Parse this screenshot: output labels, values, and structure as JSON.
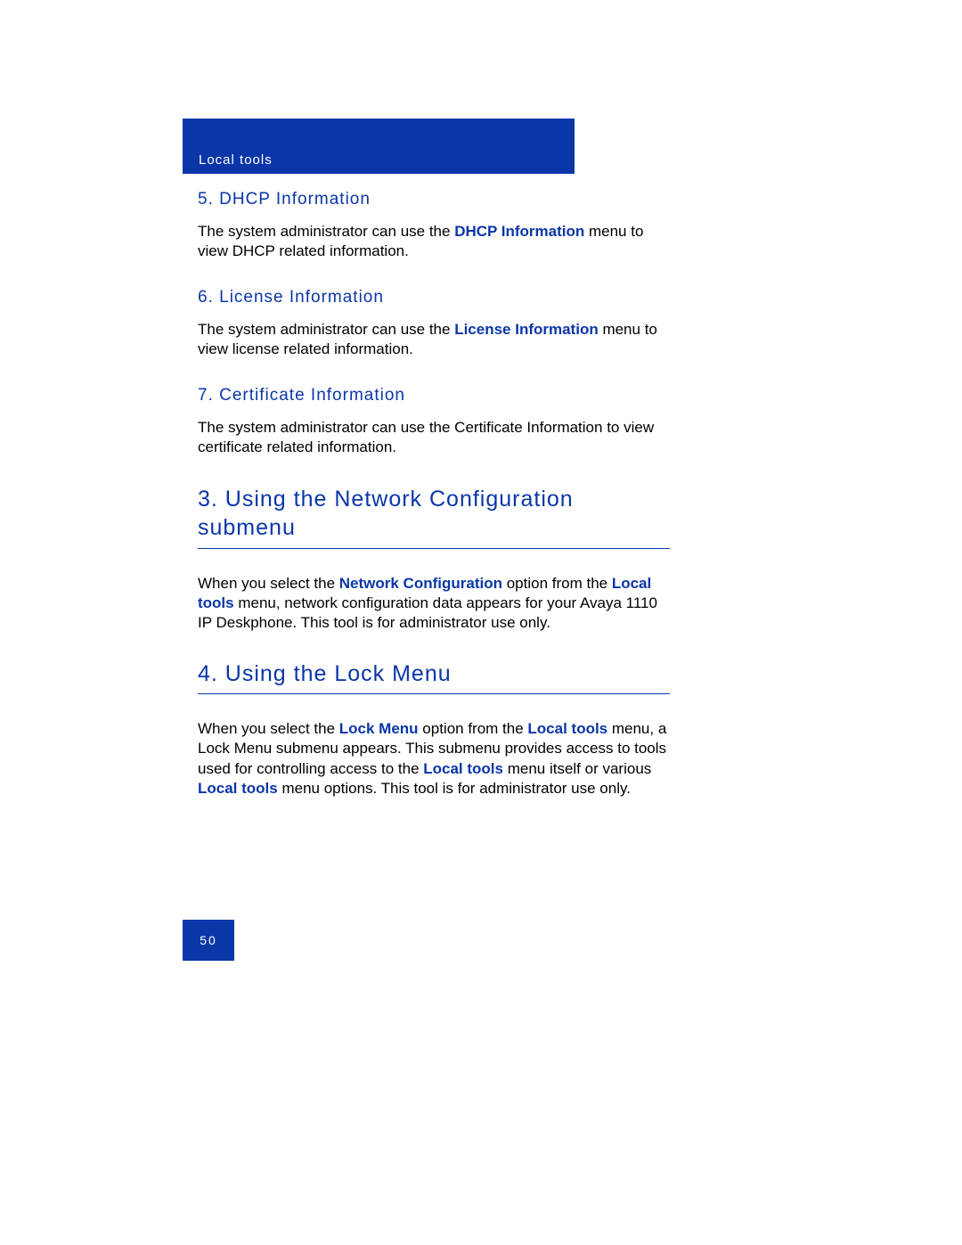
{
  "header": {
    "label": "Local tools"
  },
  "section5": {
    "heading": "5. DHCP Information",
    "text_before": "The system administrator can use the ",
    "bold": "DHCP Information",
    "text_after": " menu to view DHCP related information."
  },
  "section6": {
    "heading": "6. License Information",
    "text_before": "The system administrator can use the ",
    "bold": "License Information",
    "text_after": " menu to view license related information."
  },
  "section7": {
    "heading": "7. Certificate Information",
    "text": "The system administrator can use the Certificate Information to view certificate related information."
  },
  "section_net": {
    "heading": "3. Using the Network Configuration submenu",
    "p1a": "When you select the ",
    "p1b": "Network Configuration",
    "p1c": " option from the ",
    "p1d": "Local tools",
    "p1e": " menu, network configuration data appears for your Avaya 1110 IP Deskphone. This tool is for administrator use only."
  },
  "section_lock": {
    "heading": "4. Using the Lock Menu",
    "p1a": "When you select the ",
    "p1b": "Lock Menu",
    "p1c": " option from the ",
    "p1d": "Local tools",
    "p1e": " menu, a Lock Menu submenu appears. This submenu provides access to tools used for controlling access to the ",
    "p1f": "Local tools",
    "p1g": " menu itself or various ",
    "p1h": "Local tools",
    "p1i": " menu options. This tool is for administrator use only."
  },
  "page_number": "50"
}
